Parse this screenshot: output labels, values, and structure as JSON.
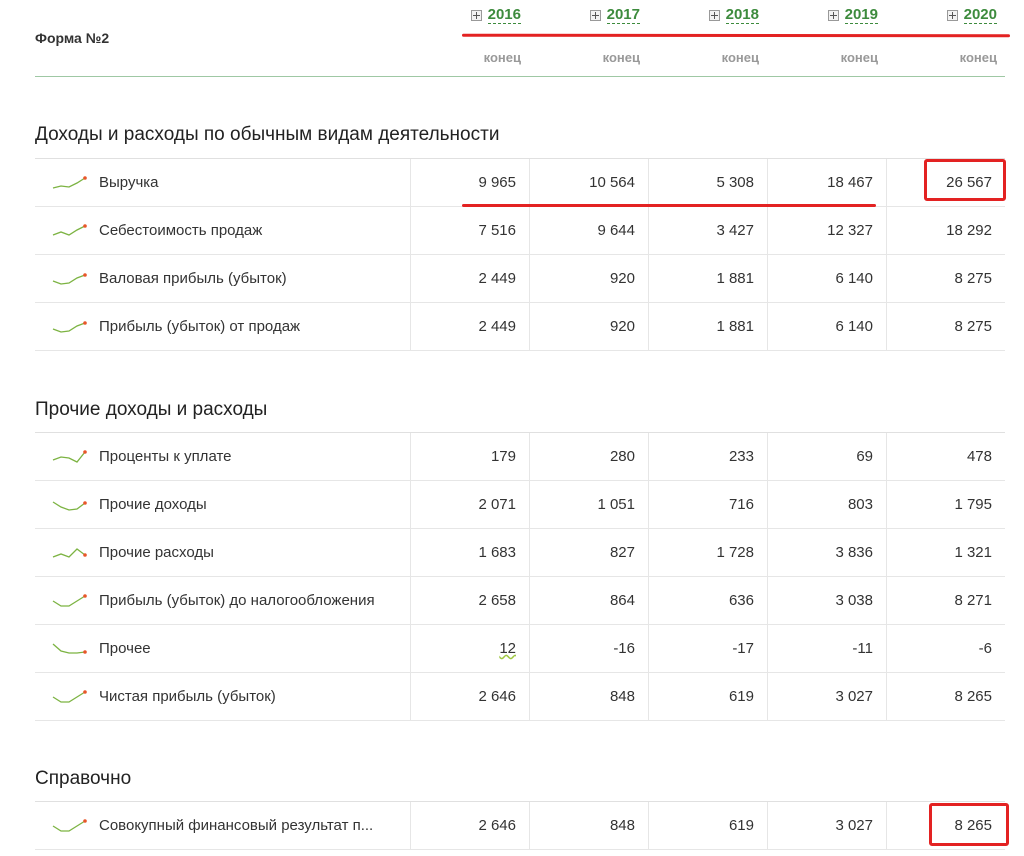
{
  "header": {
    "form_title": "Форма №2",
    "years": [
      {
        "label": "2016",
        "sub": "конец"
      },
      {
        "label": "2017",
        "sub": "конец"
      },
      {
        "label": "2018",
        "sub": "конец"
      },
      {
        "label": "2019",
        "sub": "конец"
      },
      {
        "label": "2020",
        "sub": "конец"
      }
    ]
  },
  "sections": [
    {
      "title": "Доходы и расходы по обычным видам деятельности",
      "rows": [
        {
          "name": "Выручка",
          "values": [
            "9 965",
            "10 564",
            "5 308",
            "18 467",
            "26 567"
          ]
        },
        {
          "name": "Себестоимость продаж",
          "values": [
            "7 516",
            "9 644",
            "3 427",
            "12 327",
            "18 292"
          ]
        },
        {
          "name": "Валовая прибыль (убыток)",
          "values": [
            "2 449",
            "920",
            "1 881",
            "6 140",
            "8 275"
          ]
        },
        {
          "name": "Прибыль (убыток) от продаж",
          "values": [
            "2 449",
            "920",
            "1 881",
            "6 140",
            "8 275"
          ]
        }
      ]
    },
    {
      "title": "Прочие доходы и расходы",
      "rows": [
        {
          "name": "Проценты к уплате",
          "values": [
            "179",
            "280",
            "233",
            "69",
            "478"
          ]
        },
        {
          "name": "Прочие доходы",
          "values": [
            "2 071",
            "1 051",
            "716",
            "803",
            "1 795"
          ]
        },
        {
          "name": "Прочие расходы",
          "values": [
            "1 683",
            "827",
            "1 728",
            "3 836",
            "1 321"
          ]
        },
        {
          "name": "Прибыль (убыток) до налогообложения",
          "values": [
            "2 658",
            "864",
            "636",
            "3 038",
            "8 271"
          ]
        },
        {
          "name": "Прочее",
          "values": [
            "12",
            "-16",
            "-17",
            "-11",
            "-6"
          ]
        },
        {
          "name": "Чистая прибыль (убыток)",
          "values": [
            "2 646",
            "848",
            "619",
            "3 027",
            "8 265"
          ]
        }
      ]
    },
    {
      "title": "Справочно",
      "rows": [
        {
          "name": "Совокупный финансовый результат п...",
          "values": [
            "2 646",
            "848",
            "619",
            "3 027",
            "8 265"
          ]
        }
      ]
    }
  ],
  "colors": {
    "accent_green": "#3d8b3d",
    "sparkline": "#7cb342",
    "spark_dot": "#e8562a",
    "annotation_red": "#e32222"
  },
  "icons": {
    "year_toggle": "plus-square-icon",
    "row_trend": "sparkline-icon"
  }
}
